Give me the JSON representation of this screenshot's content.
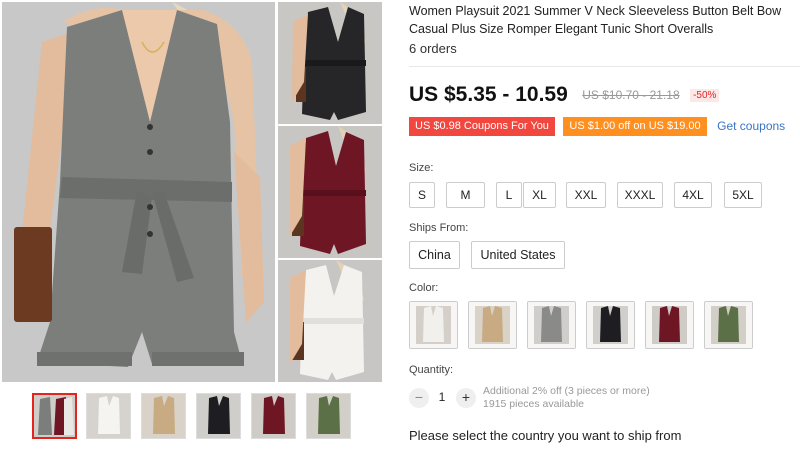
{
  "product": {
    "title": "Women Playsuit 2021 Summer V Neck Sleeveless Button Belt Bow Casual Plus Size Romper Elegant Tunic Short Overalls",
    "orders": "6 orders"
  },
  "price": {
    "current": "US $5.35 - 10.59",
    "original": "US $10.70 - 21.18",
    "discount": "-50%"
  },
  "coupons": {
    "coupon1": "US $0.98 Coupons For You",
    "coupon2": "US $1.00 off on US $19.00",
    "get_label": "Get coupons",
    "coupon1_color": "#f2473f",
    "coupon2_color": "#ff8f1f"
  },
  "size": {
    "label": "Size:",
    "options": [
      "S",
      "M",
      "L",
      "XL",
      "XXL",
      "XXXL",
      "4XL",
      "5XL"
    ]
  },
  "ships_from": {
    "label": "Ships From:",
    "options": [
      "China",
      "United States"
    ]
  },
  "color": {
    "label": "Color:",
    "swatches": [
      {
        "name": "white",
        "hex": "#f2f0ec"
      },
      {
        "name": "khaki",
        "hex": "#c8ab82"
      },
      {
        "name": "gray",
        "hex": "#8a8b89"
      },
      {
        "name": "black",
        "hex": "#1e1e22"
      },
      {
        "name": "burgundy",
        "hex": "#6e1624"
      },
      {
        "name": "green",
        "hex": "#5c7047"
      }
    ]
  },
  "quantity": {
    "label": "Quantity:",
    "value": "1",
    "minus": "−",
    "plus": "+",
    "note_line1": "Additional 2% off (3 pieces or more)",
    "note_line2": "1915 pieces available"
  },
  "shipping_message": "Please select the country you want to ship from",
  "gallery": {
    "thumbnails": [
      "gray-thumb",
      "white-thumb",
      "khaki-thumb",
      "black-thumb",
      "burgundy-thumb",
      "green-thumb"
    ],
    "accent": "#e2251e"
  }
}
